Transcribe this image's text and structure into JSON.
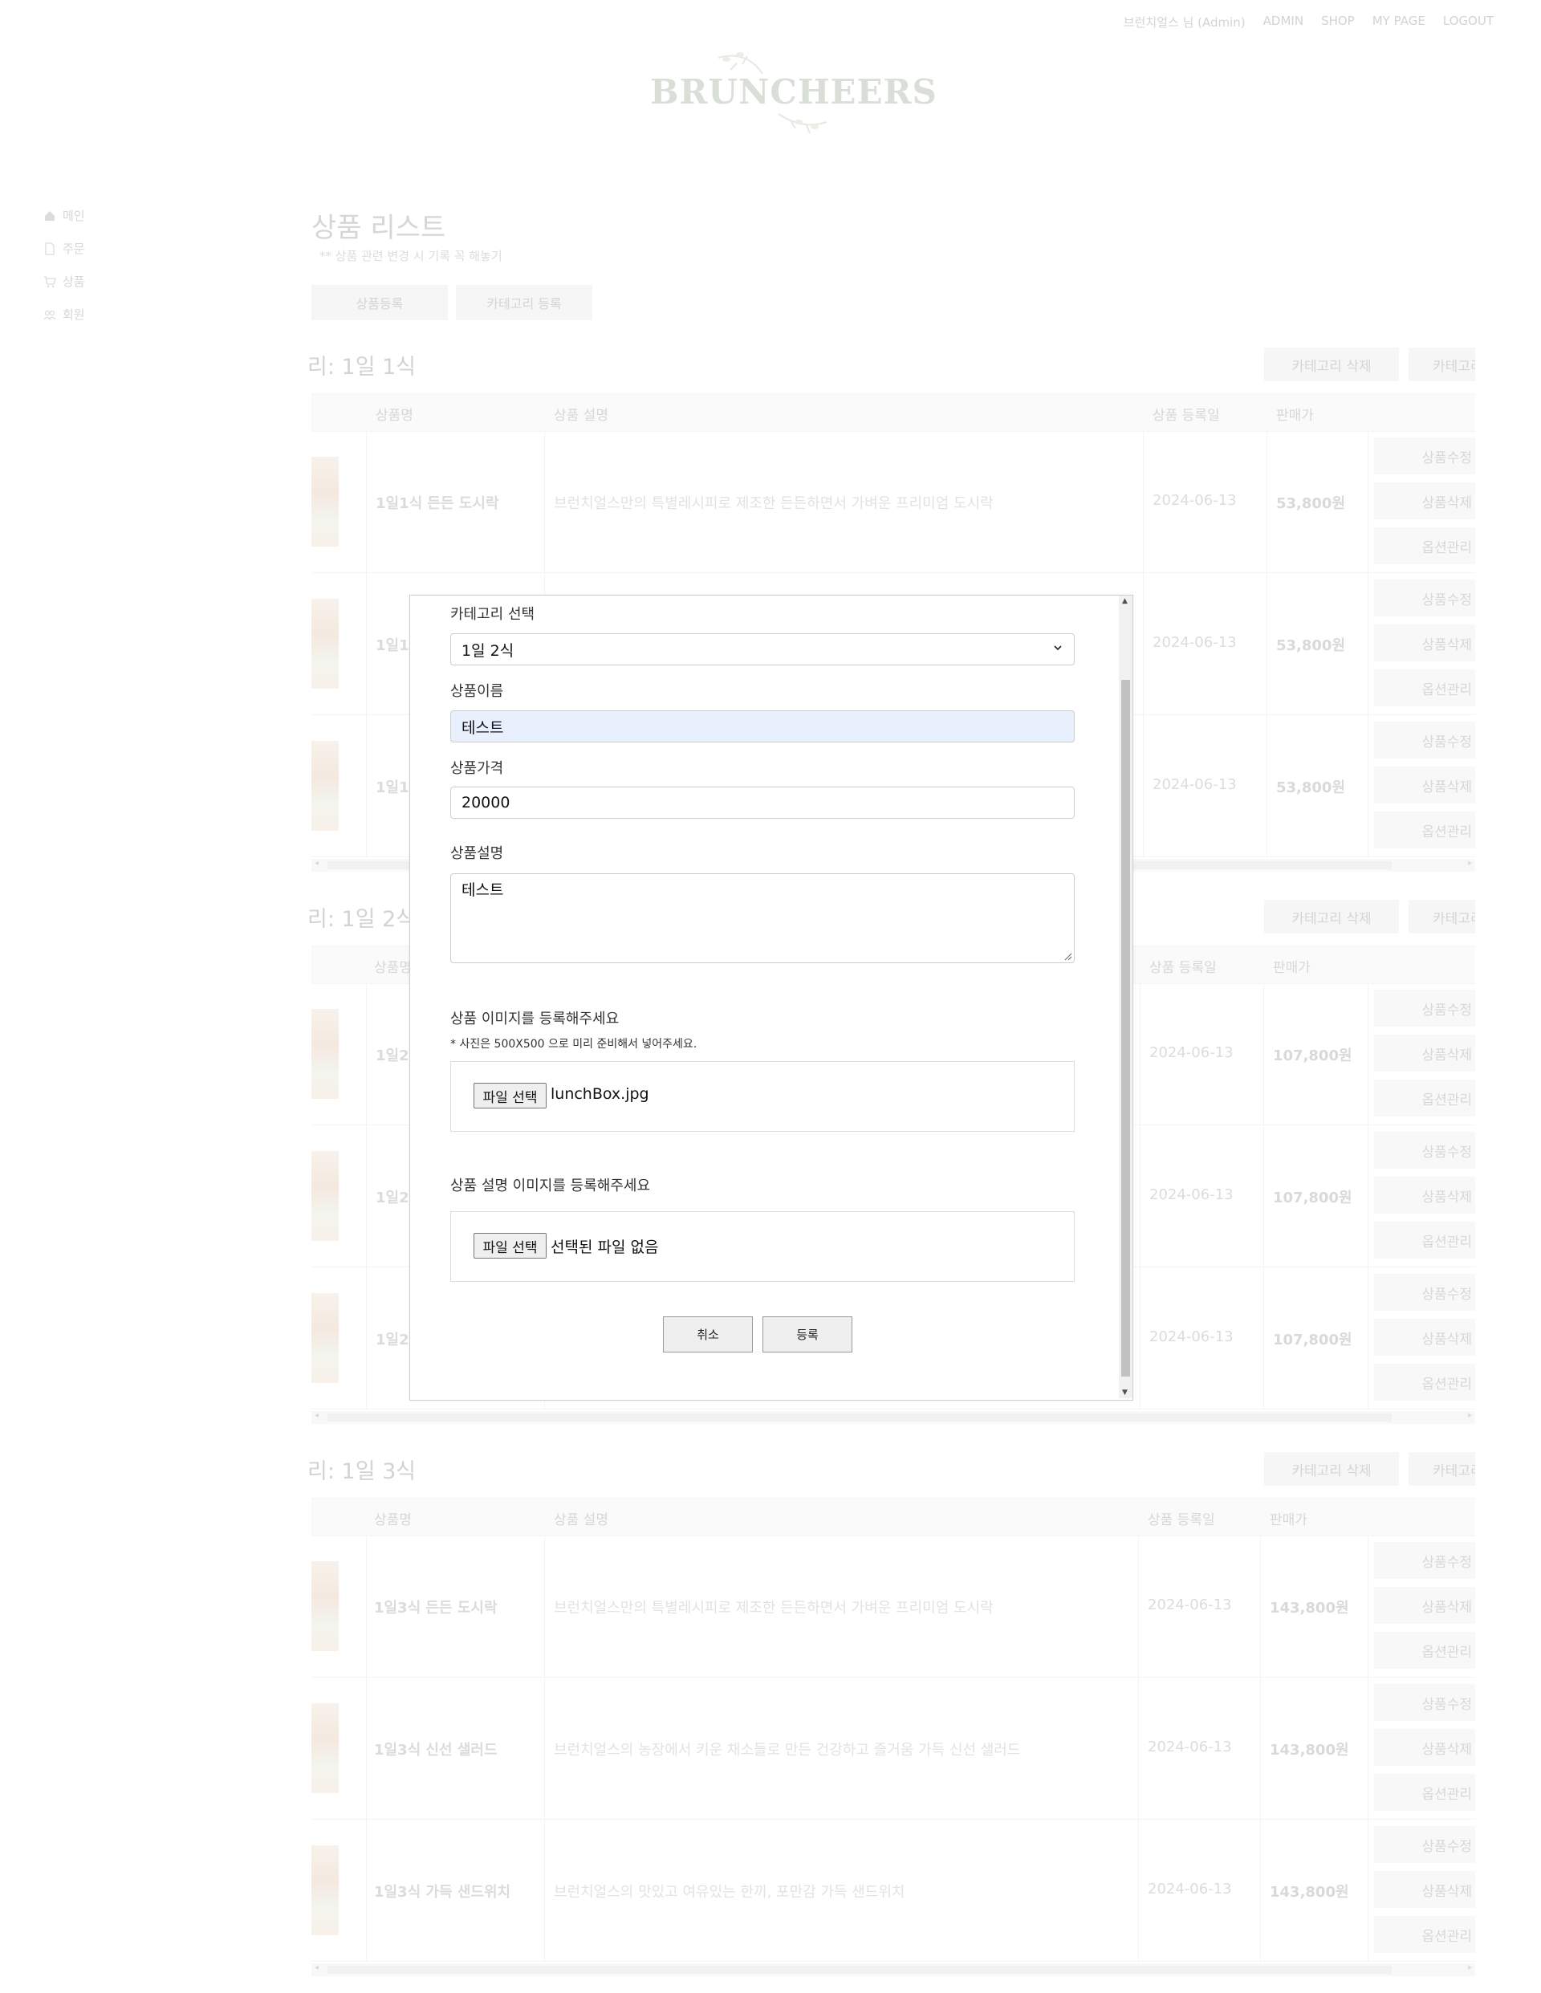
{
  "topnav": [
    "브런치얼스 님 (Admin)",
    "ADMIN",
    "SHOP",
    "MY PAGE",
    "LOGOUT"
  ],
  "logo": "BRUNCHEERS",
  "sidebar": [
    {
      "label": "메인",
      "icon": "home-icon"
    },
    {
      "label": "주문",
      "icon": "document-icon"
    },
    {
      "label": "상품",
      "icon": "cart-icon"
    },
    {
      "label": "회원",
      "icon": "users-icon"
    }
  ],
  "page": {
    "title": "상품 리스트",
    "note": "** 상품 관련 변경 시 기록 꼭 해놓기",
    "buttons": [
      "상품등록",
      "카테고리 등록"
    ]
  },
  "table_columns": [
    "상품명",
    "상품 설명",
    "상품 등록일",
    "판매가"
  ],
  "row_actions": [
    "상품수정",
    "상품삭제",
    "옵션관리"
  ],
  "category_buttons": [
    "카테고리 삭제",
    "카테고리 수정"
  ],
  "categories": [
    {
      "title": "리: 1일 1식",
      "rows": [
        {
          "name": "1일1식 든든 도시락",
          "desc": "브런치얼스만의 특별레시피로 제조한 든든하면서 가벼운 프리미엄 도시락",
          "date": "2024-06-13",
          "price": "53,800원"
        },
        {
          "name": "1일1식",
          "desc": "",
          "date": "2024-06-13",
          "price": "53,800원"
        },
        {
          "name": "1일1식",
          "desc": "",
          "date": "2024-06-13",
          "price": "53,800원"
        }
      ]
    },
    {
      "title": "리: 1일 2식",
      "rows": [
        {
          "name": "1일2식",
          "desc": "",
          "date": "2024-06-13",
          "price": "107,800원"
        },
        {
          "name": "1일2식",
          "desc": "",
          "date": "2024-06-13",
          "price": "107,800원"
        },
        {
          "name": "1일2식",
          "desc": "",
          "date": "2024-06-13",
          "price": "107,800원"
        }
      ]
    },
    {
      "title": "리: 1일 3식",
      "rows": [
        {
          "name": "1일3식 든든 도시락",
          "desc": "브런치얼스만의 특별레시피로 제조한 든든하면서 가벼운 프리미엄 도시락",
          "date": "2024-06-13",
          "price": "143,800원"
        },
        {
          "name": "1일3식 신선 샐러드",
          "desc": "브런치얼스의 농장에서 키운 채소들로 만든 건강하고 즐거움 가득 신선 샐러드",
          "date": "2024-06-13",
          "price": "143,800원"
        },
        {
          "name": "1일3식 가득 샌드위치",
          "desc": "브런치얼스의 맛있고 여유있는 한끼, 포만감 가득 샌드위치",
          "date": "2024-06-13",
          "price": "143,800원"
        }
      ]
    }
  ],
  "modal": {
    "category_label": "카테고리 선택",
    "category_value": "1일 2식",
    "name_label": "상품이름",
    "name_value": "테스트",
    "price_label": "상품가격",
    "price_value": "20000",
    "desc_label": "상품설명",
    "desc_value": "테스트",
    "image_label": "상품 이미지를 등록해주세요",
    "image_hint": "* 사진은 500X500 으로 미리 준비해서 넣어주세요.",
    "file_button": "파일 선택",
    "image_file": "lunchBox.jpg",
    "detail_image_label": "상품 설명 이미지를 등록해주세요",
    "detail_file": "선택된 파일 없음",
    "cancel": "취소",
    "submit": "등록"
  }
}
